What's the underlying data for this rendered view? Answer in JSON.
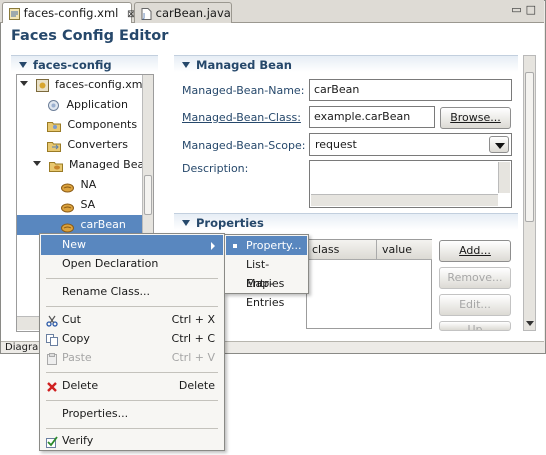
{
  "tabs": [
    {
      "label": "faces-config.xml",
      "close": "⊠",
      "active": true
    },
    {
      "label": "carBean.java",
      "active": false
    }
  ],
  "window_controls": "▭□",
  "editor_title": "Faces Config Editor",
  "tree": {
    "section_title": "faces-config",
    "nodes": [
      {
        "label": "faces-config.xml",
        "icon": "faces-config-file-icon"
      },
      {
        "label": "Application",
        "icon": "application-icon"
      },
      {
        "label": "Components",
        "icon": "components-folder-icon"
      },
      {
        "label": "Converters",
        "icon": "converters-folder-icon"
      },
      {
        "label": "Managed Bean",
        "icon": "managed-bean-folder-icon"
      },
      {
        "label": "NA",
        "icon": "bean-icon"
      },
      {
        "label": "SA",
        "icon": "bean-icon"
      },
      {
        "label": "carBean",
        "icon": "bean-icon",
        "selected": true
      }
    ]
  },
  "managed_bean": {
    "section_title": "Managed Bean",
    "name_label": "Managed-Bean-Name:",
    "name_value": "carBean",
    "class_label": "Managed-Bean-Class:",
    "class_value": "example.carBean",
    "browse_label": "Browse...",
    "scope_label": "Managed-Bean-Scope:",
    "scope_value": "request",
    "description_label": "Description:",
    "description_value": ""
  },
  "properties": {
    "section_title": "Properties",
    "columns": [
      "class",
      "value"
    ],
    "buttons": {
      "add": "Add...",
      "remove": "Remove...",
      "edit": "Edit...",
      "up": "Up"
    }
  },
  "status_text": "Diagra",
  "context_menu": {
    "items": [
      {
        "label": "New",
        "accel": "",
        "submenu": true,
        "highlighted": true
      },
      {
        "label": "Open Declaration",
        "accel": ""
      },
      {
        "label": "Rename Class...",
        "accel": ""
      },
      {
        "label": "Cut",
        "accel": "Ctrl + X",
        "icon": "scissors-icon"
      },
      {
        "label": "Copy",
        "accel": "Ctrl + C",
        "icon": "copy-icon"
      },
      {
        "label": "Paste",
        "accel": "Ctrl + V",
        "icon": "paste-icon",
        "disabled": true
      },
      {
        "label": "Delete",
        "accel": "Delete",
        "icon": "delete-x-icon"
      },
      {
        "label": "Properties...",
        "accel": ""
      },
      {
        "label": "Verify",
        "accel": "",
        "icon": "verify-icon"
      }
    ],
    "submenu": [
      {
        "label": "Property...",
        "highlighted": true
      },
      {
        "label": "List-Entries"
      },
      {
        "label": "Map-Entries"
      }
    ]
  },
  "colors": {
    "accent": "#5987bf",
    "title": "#26486b"
  }
}
